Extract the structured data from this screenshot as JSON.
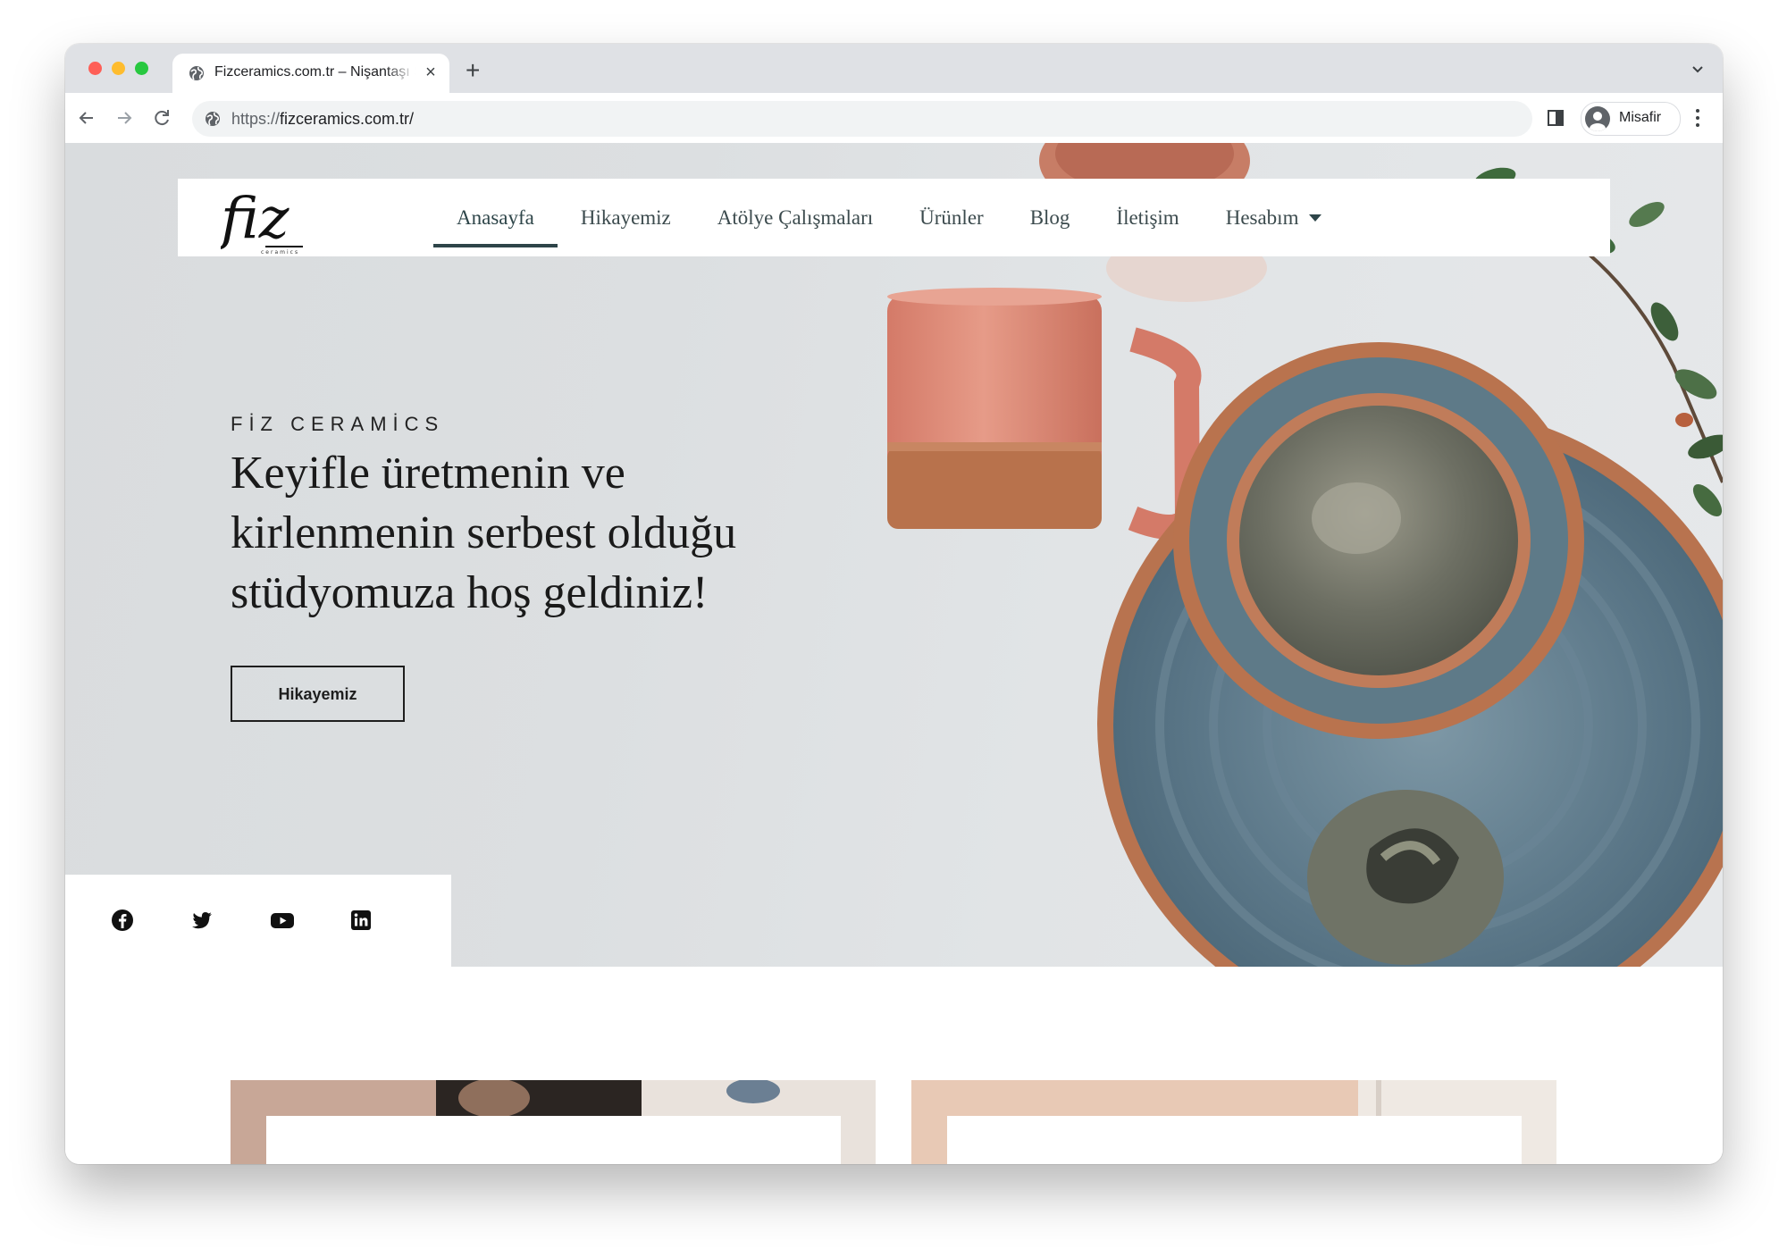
{
  "browser": {
    "tab_title": "Fizceramics.com.tr – Nişantaşı Seramik Atölyesi",
    "url_scheme": "https://",
    "url_rest": "fizceramics.com.tr/",
    "profile_name": "Misafir",
    "icons": [
      "globe-icon",
      "close-icon",
      "plus-icon",
      "chevron-down-icon",
      "back-arrow-icon",
      "forward-arrow-icon",
      "reload-icon",
      "side-panel-icon",
      "avatar-icon",
      "kebab-menu-icon"
    ]
  },
  "site": {
    "logo_text": "fiz",
    "logo_sub": "ceramics",
    "nav": [
      {
        "label": "Anasayfa",
        "active": true
      },
      {
        "label": "Hikayemiz",
        "active": false
      },
      {
        "label": "Atölye Çalışmaları",
        "active": false
      },
      {
        "label": "Ürünler",
        "active": false
      },
      {
        "label": "Blog",
        "active": false
      },
      {
        "label": "İletişim",
        "active": false
      },
      {
        "label": "Hesabım",
        "active": false,
        "dropdown": true
      }
    ],
    "hero": {
      "eyebrow": "FİZ CERAMİCS",
      "headline": "Keyifle üretmenin ve kirlenmenin serbest olduğu stüdyomuza hoş geldiniz!",
      "cta_label": "Hikayemiz"
    },
    "social_icons": [
      "facebook-icon",
      "twitter-icon",
      "youtube-icon",
      "linkedin-icon"
    ],
    "colors": {
      "accent": "#2e4549",
      "hero_bg": "#dfe2e4",
      "mug": "#d98371",
      "plate_glaze": "#5f7b8c",
      "clay": "#b6714d"
    }
  }
}
